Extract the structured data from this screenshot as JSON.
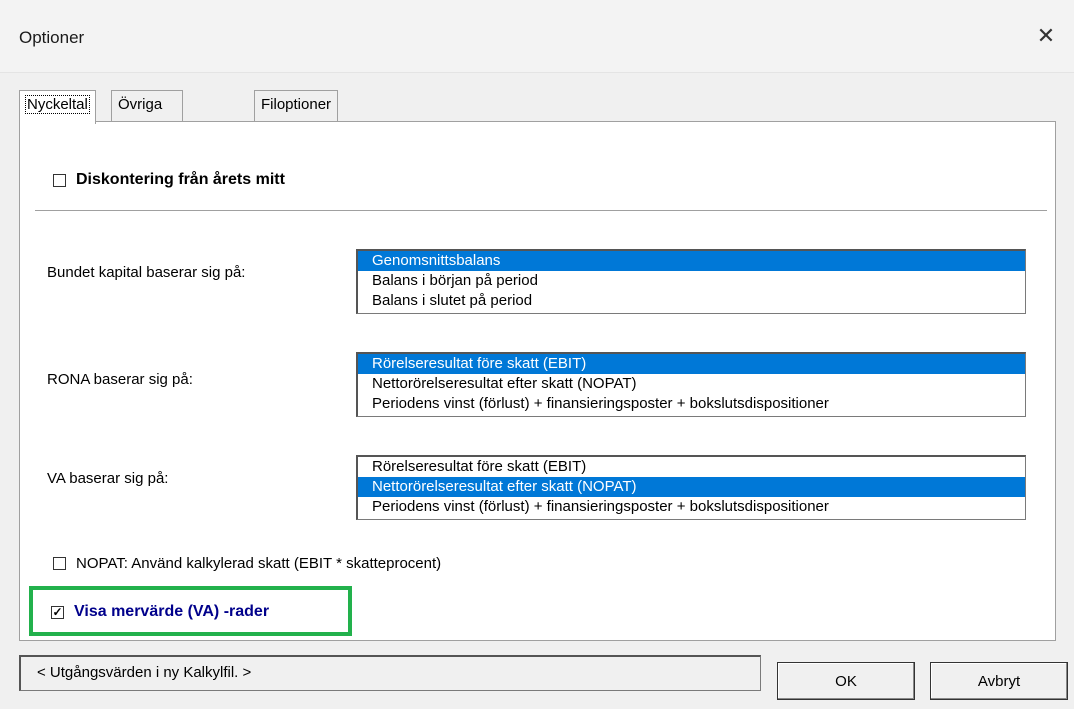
{
  "window": {
    "title": "Optioner",
    "close_glyph": "✕"
  },
  "tabs": [
    {
      "label": "Nyckeltal",
      "active": true
    },
    {
      "label": "Övriga Optioner",
      "active": false
    },
    {
      "label": "Filoptioner",
      "active": false
    }
  ],
  "options": {
    "discount_mid_year": {
      "label": "Diskontering från årets mitt",
      "checked": false
    },
    "nopat_tax": {
      "label": "NOPAT: Använd kalkylerad skatt (EBIT * skatteprocent)",
      "checked": false
    },
    "show_va_rows": {
      "label": "Visa mervärde (VA) -rader",
      "checked": true
    }
  },
  "bound_capital": {
    "label": "Bundet kapital baserar sig på:",
    "items": [
      "Genomsnittsbalans",
      "Balans i början på period",
      "Balans i slutet på period"
    ],
    "selected_index": 0
  },
  "rona": {
    "label": "RONA baserar sig på:",
    "items": [
      "Rörelseresultat före skatt (EBIT)",
      "Nettorörelseresultat efter skatt (NOPAT)",
      "Periodens vinst (förlust) + finansieringsposter + bokslutsdispositioner"
    ],
    "selected_index": 0
  },
  "va": {
    "label": "VA baserar sig på:",
    "items": [
      "Rörelseresultat före skatt (EBIT)",
      "Nettorörelseresultat efter skatt (NOPAT)",
      "Periodens vinst (förlust) + finansieringsposter + bokslutsdispositioner"
    ],
    "selected_index": 1
  },
  "footer": {
    "defaults_label": "< Utgångsvärden i ny Kalkylfil. >",
    "ok_label": "OK",
    "cancel_label": "Avbryt"
  },
  "colors": {
    "selection": "#0078d7",
    "highlight_box": "#22b14c",
    "va_label": "#00008b"
  }
}
